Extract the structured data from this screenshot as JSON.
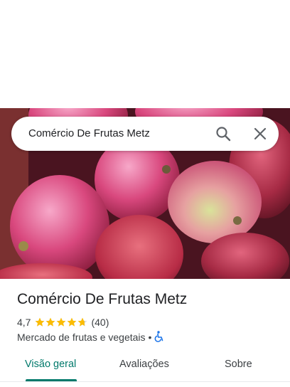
{
  "search": {
    "query": "Comércio De Frutas Metz",
    "search_icon": "search-icon",
    "close_icon": "close-icon"
  },
  "hero": {
    "image": "mangoes-photo"
  },
  "place": {
    "title": "Comércio De Frutas Metz",
    "rating": "4,7",
    "rating_value": 4.7,
    "rating_max": 5,
    "review_count": "(40)",
    "category": "Mercado de frutas e vegetais",
    "separator": "•",
    "accessibility_icon": "wheelchair-icon"
  },
  "tabs": [
    {
      "label": "Visão geral",
      "active": true
    },
    {
      "label": "Avaliações",
      "active": false
    },
    {
      "label": "Sobre",
      "active": false
    }
  ],
  "colors": {
    "accent": "#00796b",
    "star": "#fbbc04",
    "accessibility": "#1a73e8"
  }
}
